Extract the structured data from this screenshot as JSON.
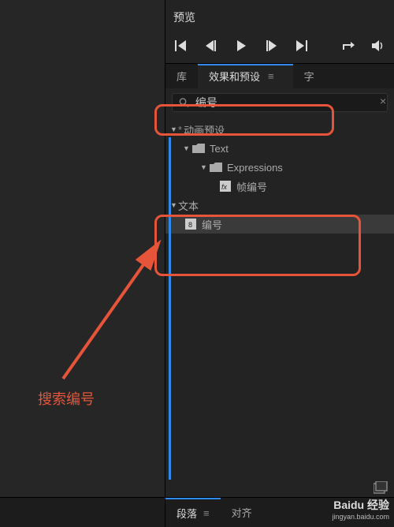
{
  "preview": {
    "title": "预览"
  },
  "tabs": {
    "lib": "库",
    "effects": "效果和预设",
    "char": "字"
  },
  "search": {
    "value": "编号"
  },
  "tree": {
    "anim_presets": "动画预设",
    "text_folder": "Text",
    "expressions": "Expressions",
    "frame_number": "帧编号",
    "text_cat": "文本",
    "number_preset": "编号"
  },
  "annotation": {
    "label": "搜索编号"
  },
  "bottom": {
    "paragraph": "段落",
    "align": "对齐"
  },
  "watermark": {
    "main": "Baidu 经验",
    "sub": "jingyan.baidu.com"
  }
}
